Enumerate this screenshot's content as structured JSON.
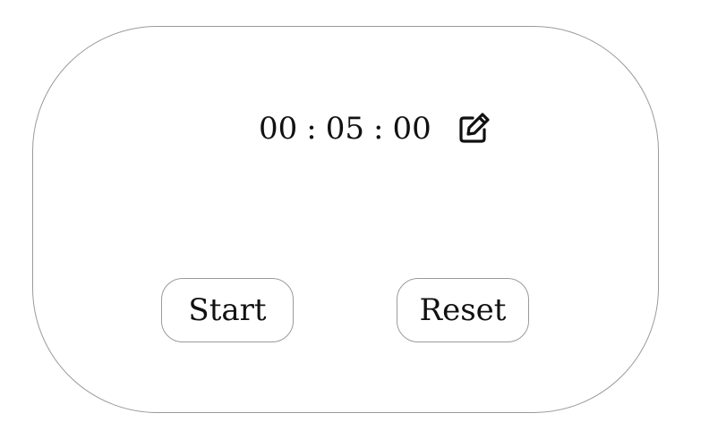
{
  "timer": {
    "hours": "00",
    "minutes": "05",
    "seconds": "00",
    "separator": ":",
    "edit_icon": "edit-pencil-square-icon"
  },
  "controls": {
    "start_label": "Start",
    "reset_label": "Reset"
  },
  "colors": {
    "border": "#9a9a9a",
    "text": "#111111",
    "background": "#ffffff"
  }
}
